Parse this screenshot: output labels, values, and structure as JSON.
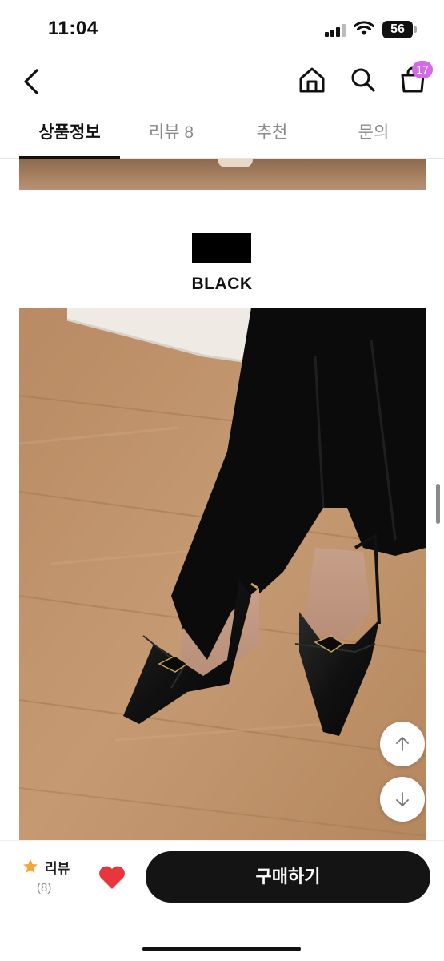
{
  "status_bar": {
    "time": "11:04",
    "battery": "56"
  },
  "header": {
    "cart_count": "17"
  },
  "tabs": [
    {
      "label": "상품정보",
      "active": true
    },
    {
      "label": "리뷰 8",
      "active": false
    },
    {
      "label": "추천",
      "active": false
    },
    {
      "label": "문의",
      "active": false
    }
  ],
  "product": {
    "color_name": "BLACK",
    "swatch_color": "#000000"
  },
  "bottom_bar": {
    "review_label": "리뷰",
    "review_count": "(8)",
    "buy_label": "구매하기"
  },
  "colors": {
    "accent_badge": "#d46ae8",
    "heart": "#e8363c",
    "star": "#f2a73b"
  },
  "icons": [
    "back-arrow-icon",
    "home-icon",
    "search-icon",
    "shopping-bag-icon",
    "arrow-up-icon",
    "arrow-down-icon",
    "star-icon",
    "heart-icon"
  ]
}
